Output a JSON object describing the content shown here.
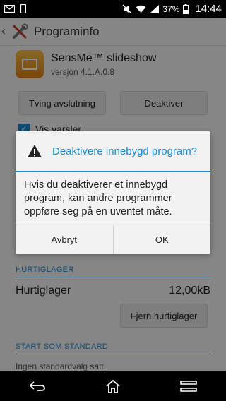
{
  "status_bar": {
    "battery_percent": "37%",
    "time": "14:44",
    "icons": [
      "gmail-icon",
      "phone-icon",
      "mute-icon",
      "wifi-icon",
      "signal-icon",
      "battery-icon"
    ]
  },
  "action_bar": {
    "title": "Programinfo",
    "icons": [
      "back-chevron-icon",
      "tools-icon"
    ]
  },
  "app": {
    "name": "SensMe™ slideshow",
    "version": "versjon 4.1.A.0.8",
    "icon": "sensme-slideshow-icon"
  },
  "buttons": {
    "force_stop": "Tving avslutning",
    "disable": "Deaktiver",
    "clear_cache": "Fjern hurtiglager"
  },
  "notifications": {
    "label": "Vis varsler",
    "checked": true
  },
  "cache_section": {
    "header": "HURTIGLAGER",
    "label": "Hurtiglager",
    "value": "12,00kB"
  },
  "default_section": {
    "header": "START SOM STANDARD",
    "text": "Ingen standardvalg satt."
  },
  "dialog": {
    "title": "Deaktivere innebygd program?",
    "message": "Hvis du deaktiverer et innebygd program, kan andre programmer oppføre seg på en uventet måte.",
    "cancel": "Avbryt",
    "ok": "OK",
    "icon": "warning-icon"
  },
  "nav_bar": {
    "icons": [
      "back-icon",
      "home-icon",
      "recents-icon"
    ]
  },
  "colors": {
    "accent": "#1a8bd1",
    "status_bar": "#000000",
    "overlay": "rgba(0,0,0,0.45)"
  }
}
